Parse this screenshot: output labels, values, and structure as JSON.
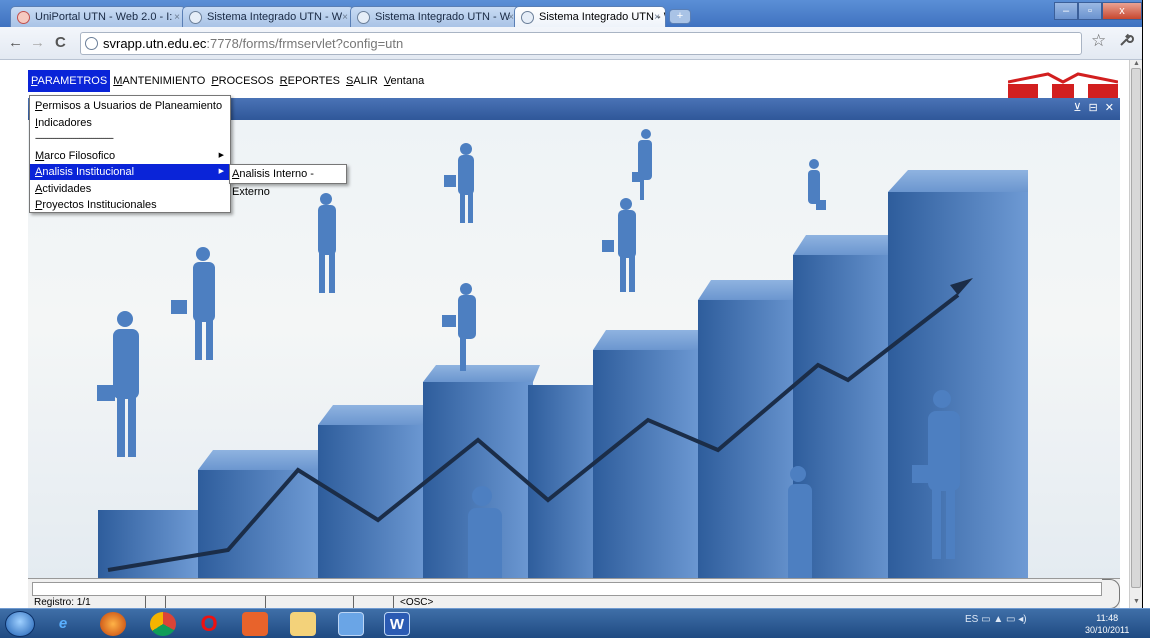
{
  "browser": {
    "tabs": [
      {
        "title": "UniPortal UTN - Web 2.0 - I:",
        "active": false
      },
      {
        "title": "Sistema Integrado UTN - W",
        "active": false
      },
      {
        "title": "Sistema Integrado UTN - W",
        "active": false
      },
      {
        "title": "Sistema Integrado UTN - W",
        "active": true
      }
    ],
    "tab_close": "×",
    "new_tab": "+",
    "window_buttons": {
      "minimize": "–",
      "maximize": "▫",
      "close": "x"
    },
    "url_host": "svrapp.utn.edu.ec",
    "url_rest": ":7778/forms/frmservlet?config=utn",
    "back": "←",
    "forward": "→",
    "reload": "C",
    "bookmark": "☆",
    "wrench": "🔧"
  },
  "menubar": {
    "items": [
      {
        "first": "P",
        "rest": "ARAMETROS"
      },
      {
        "first": "M",
        "rest": "ANTENIMIENTO"
      },
      {
        "first": "P",
        "rest": "ROCESOS"
      },
      {
        "first": "R",
        "rest": "EPORTES"
      },
      {
        "first": "S",
        "rest": "ALIR"
      },
      {
        "first": "V",
        "rest": "entana"
      }
    ]
  },
  "dropdown": {
    "items": [
      {
        "first": "P",
        "rest": "ermisos a Usuarios de Planeamiento"
      },
      {
        "first": "I",
        "rest": "ndicadores"
      },
      {
        "first": "M",
        "rest": "arco Filosofico"
      },
      {
        "first": "A",
        "rest": "nalisis Institucional"
      },
      {
        "first": "A",
        "rest": "ctividades"
      },
      {
        "first": "P",
        "rest": "royectos Institucionales"
      }
    ],
    "separator": "---------------------------------------",
    "submenu_arrow": "▶"
  },
  "submenu": {
    "first": "A",
    "rest": "nalisis Interno - Externo"
  },
  "internal_window": {
    "controls": "⊻ ⊟ ✕"
  },
  "statusbar": {
    "registro": "Registro: 1/1",
    "osc": "<OSC>"
  },
  "taskbar": {
    "tray": "ES ▭ ▲ ▭ ◂)",
    "time": "11:48",
    "date": "30/10/2011"
  },
  "colors": {
    "menu_highlight": "#0a24d8",
    "window_title": "#3f66a8",
    "chart_blue": "#4d7fc1"
  }
}
